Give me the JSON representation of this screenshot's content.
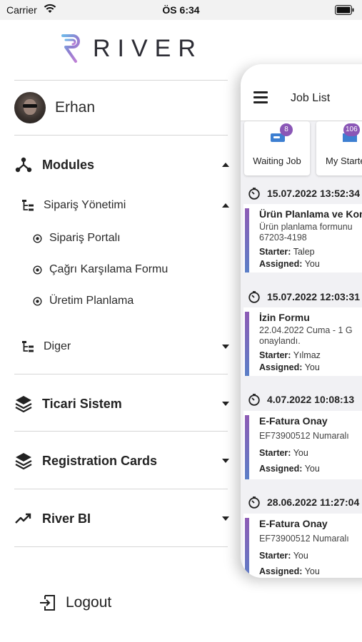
{
  "status_bar": {
    "carrier": "Carrier",
    "time": "ÖS 6:34"
  },
  "logo": {
    "text": "RIVER"
  },
  "profile": {
    "name": "Erhan"
  },
  "menu": {
    "modules": "Modules",
    "siparis_yonetimi": "Sipariş Yönetimi",
    "siparis_portali": "Sipariş Portalı",
    "cagri_karsilama": "Çağrı Karşılama Formu",
    "uretim_planlama": "Üretim Planlama",
    "diger": "Diger",
    "ticari_sistem": "Ticari Sistem",
    "registration_cards": "Registration Cards",
    "river_bi": "River BI",
    "logout": "Logout"
  },
  "job_list": {
    "title": "Job List",
    "tabs": [
      {
        "label": "Waiting Job",
        "badge": "8"
      },
      {
        "label": "My Starte",
        "badge": "106"
      }
    ],
    "labels": {
      "starter": "Starter:",
      "assigned": "Assigned:"
    },
    "jobs": [
      {
        "date": "15.07.2022 13:52:34",
        "title": "Ürün Planlama ve Kon",
        "desc1": "Ürün planlama formunu",
        "desc2": "67203-4198",
        "starter": "Talep",
        "assigned": "You"
      },
      {
        "date": "15.07.2022 12:03:31",
        "title": "İzin Formu",
        "desc1": "22.04.2022 Cuma - 1 G",
        "desc2": "onaylandı.",
        "starter": "Yılmaz",
        "assigned": "You"
      },
      {
        "date": "4.07.2022 10:08:13",
        "title": "E-Fatura Onay",
        "desc1": "EF73900512 Numaralı",
        "desc2": "",
        "starter": "You",
        "assigned": "You"
      },
      {
        "date": "28.06.2022 11:27:04",
        "title": "E-Fatura Onay",
        "desc1": "EF73900512 Numaralı",
        "desc2": "",
        "starter": "You",
        "assigned": "You"
      }
    ]
  },
  "colors": {
    "accent_purple": "#8a56b6",
    "accent_blue": "#5b7fc7",
    "divider": "#d6d6d6"
  }
}
